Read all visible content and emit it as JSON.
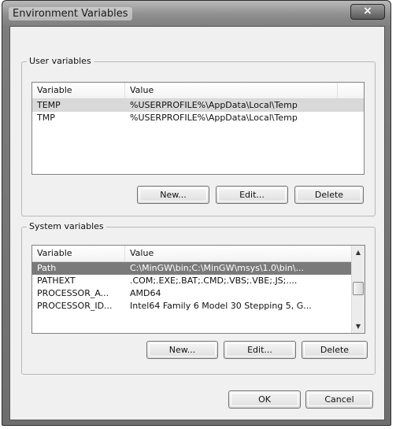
{
  "window": {
    "title": "Environment Variables",
    "close_glyph": "×"
  },
  "user_vars": {
    "group_label": "User variables",
    "columns": [
      "Variable",
      "Value"
    ],
    "rows": [
      {
        "variable": "TEMP",
        "value": "%USERPROFILE%\\AppData\\Local\\Temp"
      },
      {
        "variable": "TMP",
        "value": "%USERPROFILE%\\AppData\\Local\\Temp"
      }
    ],
    "buttons": {
      "new": "New...",
      "edit": "Edit...",
      "delete": "Delete"
    }
  },
  "system_vars": {
    "group_label": "System variables",
    "columns": [
      "Variable",
      "Value"
    ],
    "rows": [
      {
        "variable": "Path",
        "value": "C:\\MinGW\\bin;C:\\MinGW\\msys\\1.0\\bin\\..."
      },
      {
        "variable": "PATHEXT",
        "value": ".COM;.EXE;.BAT;.CMD;.VBS;.VBE;.JS;...."
      },
      {
        "variable": "PROCESSOR_A...",
        "value": "AMD64"
      },
      {
        "variable": "PROCESSOR_ID...",
        "value": "Intel64 Family 6 Model 30 Stepping 5, G..."
      }
    ],
    "buttons": {
      "new": "New...",
      "edit": "Edit...",
      "delete": "Delete"
    },
    "scrollbar": {
      "up_glyph": "▲",
      "down_glyph": "▼"
    }
  },
  "dialog": {
    "ok": "OK",
    "cancel": "Cancel"
  }
}
